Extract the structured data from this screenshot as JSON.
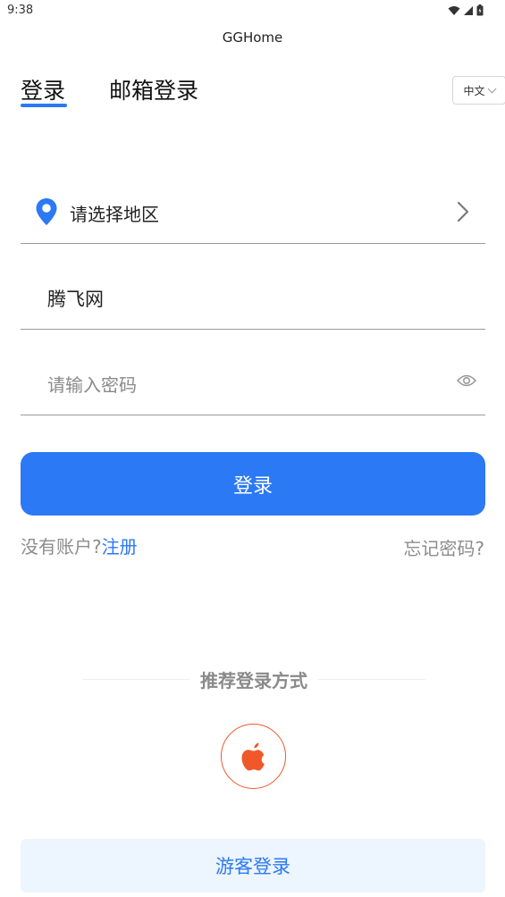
{
  "status_bar": {
    "time": "9:38",
    "icons": [
      "wifi-icon",
      "signal-icon",
      "battery-charging-icon"
    ]
  },
  "app": {
    "title": "GGHome"
  },
  "tabs": [
    {
      "label": "登录",
      "active": true
    },
    {
      "label": "邮箱登录",
      "active": false
    }
  ],
  "language": {
    "selected": "中文"
  },
  "form": {
    "region_placeholder": "请选择地区",
    "account_value": "腾飞网",
    "password_placeholder": "请输入密码",
    "login_label": "登录"
  },
  "links": {
    "no_account": "没有账户?",
    "register": "注册",
    "forgot_password": "忘记密码?"
  },
  "recommend": {
    "title": "推荐登录方式",
    "methods": [
      "apple-icon"
    ]
  },
  "guest": {
    "label": "游客登录"
  },
  "colors": {
    "accent": "#2b79f4",
    "apple_orange": "#f0582a",
    "guest_bg": "#edf5ff"
  }
}
